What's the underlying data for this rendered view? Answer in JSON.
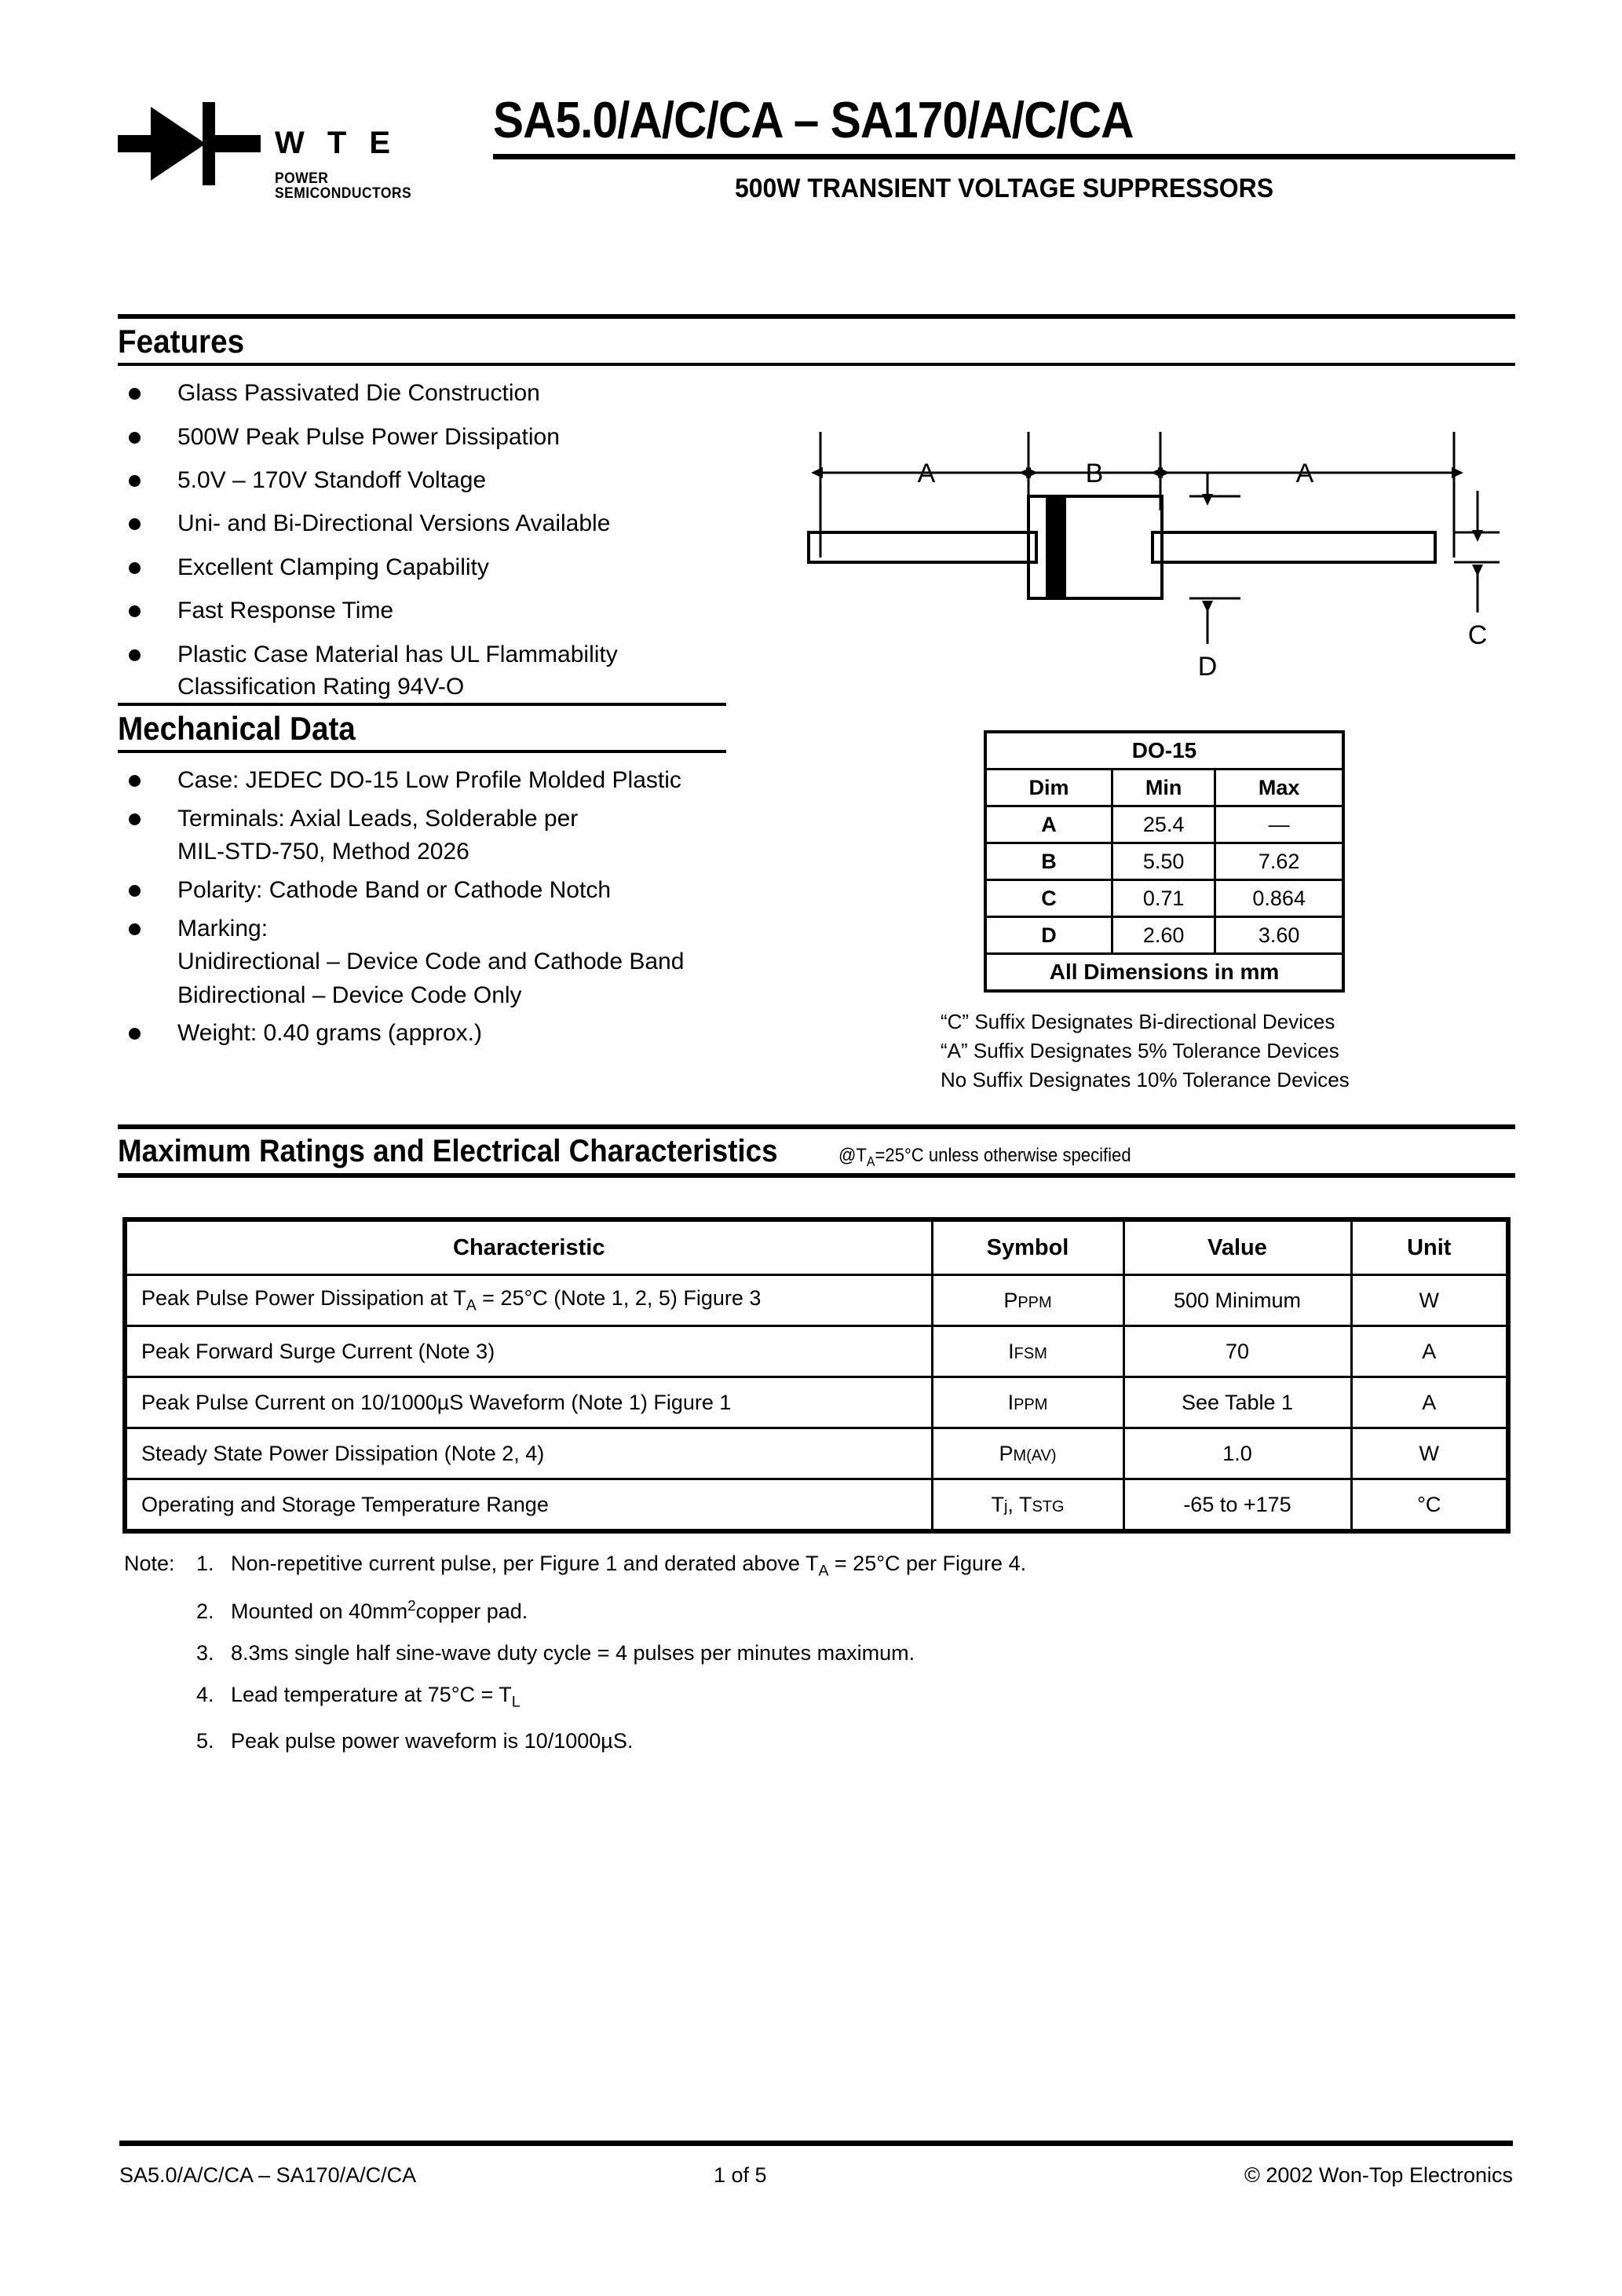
{
  "header": {
    "logo_wordmark": "W T E",
    "logo_subtext": "POWER SEMICONDUCTORS",
    "logo_icon": "diode-symbol",
    "title": "SA5.0/A/C/CA – SA170/A/C/CA",
    "subtitle": "500W TRANSIENT VOLTAGE SUPPRESSORS"
  },
  "features": {
    "heading": "Features",
    "items": [
      "Glass Passivated Die Construction",
      "500W Peak Pulse Power Dissipation",
      "5.0V – 170V Standoff Voltage",
      "Uni- and Bi-Directional Versions Available",
      "Excellent Clamping Capability",
      "Fast Response Time",
      "Plastic Case Material has UL Flammability"
    ],
    "last_item_continuation": "Classification Rating 94V-O"
  },
  "mechanical": {
    "heading": "Mechanical Data",
    "items": [
      "Case: JEDEC DO-15 Low Profile Molded Plastic",
      "Terminals: Axial Leads, Solderable per",
      "Polarity: Cathode Band or Cathode Notch",
      "Marking:",
      "Weight: 0.40 grams (approx.)"
    ],
    "terminals_continuation": "MIL-STD-750, Method 2026",
    "marking_line1": "Unidirectional – Device Code and Cathode Band",
    "marking_line2": "Bidirectional – Device Code Only"
  },
  "package_drawing": {
    "label_a_left": "A",
    "label_b": "B",
    "label_a_right": "A",
    "label_c": "C",
    "label_d": "D"
  },
  "dim_table": {
    "title": "DO-15",
    "columns": [
      "Dim",
      "Min",
      "Max"
    ],
    "rows": [
      {
        "dim": "A",
        "min": "25.4",
        "max": "—"
      },
      {
        "dim": "B",
        "min": "5.50",
        "max": "7.62"
      },
      {
        "dim": "C",
        "min": "0.71",
        "max": "0.864"
      },
      {
        "dim": "D",
        "min": "2.60",
        "max": "3.60"
      }
    ],
    "footer": "All Dimensions in mm"
  },
  "suffix_notes": [
    "“C” Suffix Designates Bi-directional Devices",
    "“A” Suffix Designates 5% Tolerance Devices",
    "No Suffix Designates 10% Tolerance Devices"
  ],
  "max_ratings": {
    "heading": "Maximum Ratings and Electrical Characteristics",
    "heading_condition": "@TA=25°C unless otherwise specified",
    "columns": [
      "Characteristic",
      "Symbol",
      "Value",
      "Unit"
    ],
    "rows": [
      {
        "characteristic": "Peak Pulse Power Dissipation at TA = 25°C (Note 1, 2, 5) Figure 3",
        "char_pre": "Peak Pulse Power Dissipation at T",
        "char_sub": "A",
        "char_post": " = 25°C (Note 1, 2, 5) Figure 3",
        "symbol_main": "P",
        "symbol_sub": "PPM",
        "value": "500 Minimum",
        "unit": "W"
      },
      {
        "characteristic": "Peak Forward Surge Current (Note 3)",
        "char_pre": "Peak Forward Surge Current (Note 3)",
        "char_sub": "",
        "char_post": "",
        "symbol_main": "I",
        "symbol_sub": "FSM",
        "value": "70",
        "unit": "A"
      },
      {
        "characteristic": "Peak Pulse Current on 10/1000µS Waveform (Note 1) Figure 1",
        "char_pre": "Peak Pulse Current on 10/1000µS Waveform (Note 1) Figure 1",
        "char_sub": "",
        "char_post": "",
        "symbol_main": "I",
        "symbol_sub": "PPM",
        "value": "See Table 1",
        "unit": "A"
      },
      {
        "characteristic": "Steady State Power Dissipation (Note 2, 4)",
        "char_pre": "Steady State Power Dissipation (Note 2, 4)",
        "char_sub": "",
        "char_post": "",
        "symbol_main": "P",
        "symbol_sub": "M(AV)",
        "value": "1.0",
        "unit": "W"
      },
      {
        "characteristic": "Operating and Storage Temperature Range",
        "char_pre": "Operating and Storage Temperature Range",
        "char_sub": "",
        "char_post": "",
        "symbol_main": "T",
        "symbol_sub": "j, TSTG",
        "value": "-65 to +175",
        "unit": "°C"
      }
    ]
  },
  "notes": {
    "label": "Note:",
    "items": [
      {
        "num": "1.",
        "text_pre": "Non-repetitive current pulse, per Figure 1 and derated above T",
        "sub": "A",
        "text_post": " = 25°C per Figure 4."
      },
      {
        "num": "2.",
        "text_pre": "Mounted on 40mm",
        "sup": "2",
        "text_post": "copper pad."
      },
      {
        "num": "3.",
        "text_pre": "8.3ms single half sine-wave duty cycle = 4 pulses per minutes maximum.",
        "text_post": ""
      },
      {
        "num": "4.",
        "text_pre": "Lead temperature at 75°C = T",
        "sub": "L",
        "text_post": ""
      },
      {
        "num": "5.",
        "text_pre": "Peak pulse power waveform is 10/1000µS.",
        "text_post": ""
      }
    ]
  },
  "footer": {
    "left": "SA5.0/A/C/CA – SA170/A/C/CA",
    "page": "1  of  5",
    "right": "© 2002 Won-Top Electronics"
  }
}
